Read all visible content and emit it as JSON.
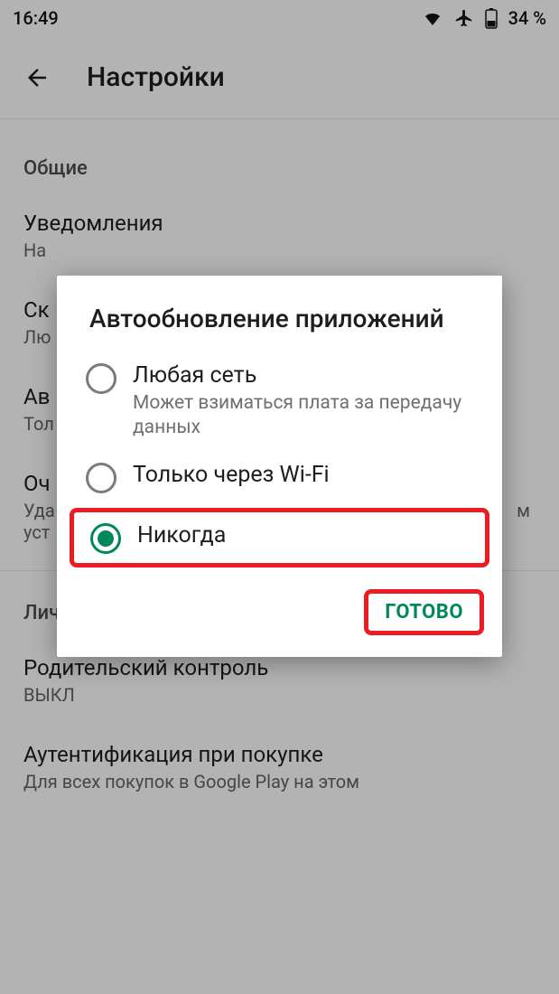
{
  "status": {
    "time": "16:49",
    "battery_text": "34 %"
  },
  "appbar": {
    "title": "Настройки"
  },
  "sections": {
    "general": "Общие",
    "personal": "Личные"
  },
  "items": {
    "notifications": {
      "title": "Уведомления",
      "subtitle": "На"
    },
    "item2": {
      "title": "Ск",
      "subtitle": "Лю"
    },
    "item3": {
      "title": "Ав",
      "subtitle": "Тол"
    },
    "item4": {
      "title": "Оч",
      "subtitle_a": "Уда",
      "subtitle_b": "м",
      "subtitle_c": "уст"
    },
    "parental": {
      "title": "Родительский контроль",
      "subtitle": "ВЫКЛ"
    },
    "auth": {
      "title": "Аутентификация при покупке",
      "subtitle": "Для всех покупок в Google Play на этом"
    }
  },
  "dialog": {
    "title": "Автообновление приложений",
    "options": [
      {
        "label": "Любая сеть",
        "sub": "Может взиматься плата за передачу данных",
        "selected": false
      },
      {
        "label": "Только через Wi-Fi",
        "sub": "",
        "selected": false
      },
      {
        "label": "Никогда",
        "sub": "",
        "selected": true
      }
    ],
    "done": "ГОТОВО"
  },
  "colors": {
    "accent": "#00885a",
    "highlight": "#ec1c24"
  }
}
